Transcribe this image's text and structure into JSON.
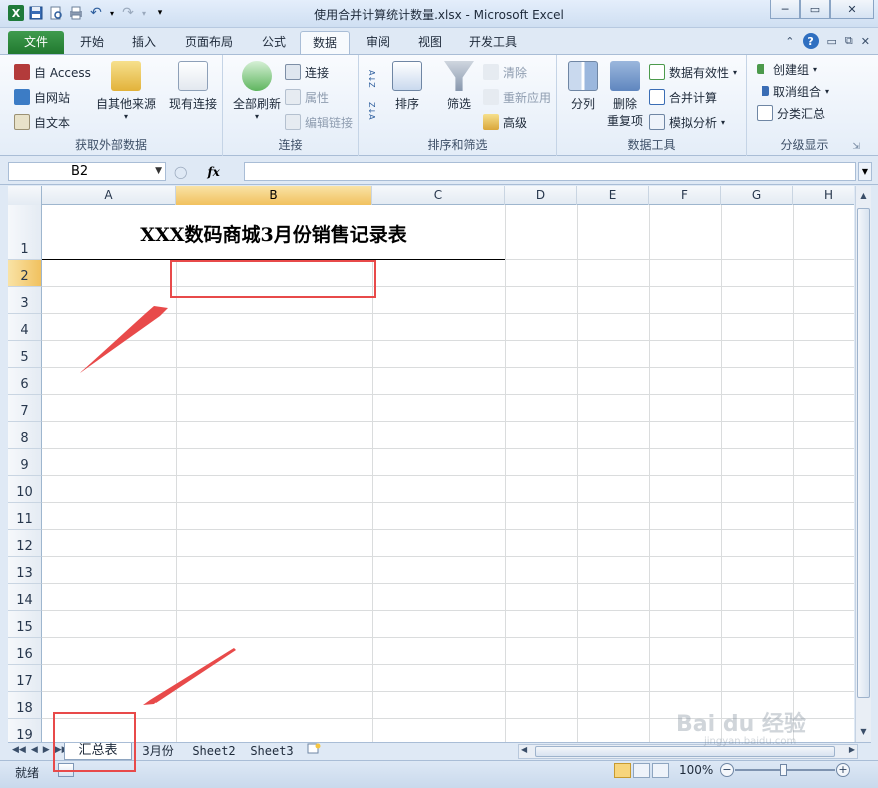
{
  "window": {
    "title": "使用合并计算统计数量.xlsx - Microsoft Excel",
    "minimize": "─",
    "maximize": "▭",
    "close": "✕"
  },
  "quick_access": {
    "excel_icon_label": "X",
    "undo": "↶",
    "redo": "↷",
    "more": "▾"
  },
  "ribbon_tabs": {
    "file": "文件",
    "home": "开始",
    "insert": "插入",
    "page_layout": "页面布局",
    "formulas": "公式",
    "data": "数据",
    "review": "审阅",
    "view": "视图",
    "developer": "开发工具",
    "help": "?"
  },
  "ribbon": {
    "get_external": {
      "access": "自 Access",
      "web": "自网站",
      "text": "自文本",
      "other_sources": "自其他来源",
      "existing_connections": "现有连接",
      "label": "获取外部数据"
    },
    "connections": {
      "refresh_all": "全部刷新",
      "connections": "连接",
      "properties": "属性",
      "edit_links": "编辑链接",
      "label": "连接"
    },
    "sort_filter": {
      "sort_az": "A↓Z",
      "sort_za": "Z↓A",
      "sort": "排序",
      "filter": "筛选",
      "clear": "清除",
      "reapply": "重新应用",
      "advanced": "高级",
      "label": "排序和筛选"
    },
    "data_tools": {
      "text_to_columns": "分列",
      "remove_duplicates_1": "删除",
      "remove_duplicates_2": "重复项",
      "data_validation": "数据有效性",
      "consolidate": "合并计算",
      "what_if": "模拟分析",
      "label": "数据工具"
    },
    "outline": {
      "group": "创建组",
      "ungroup": "取消组合",
      "subtotal": "分类汇总",
      "label": "分级显示"
    }
  },
  "formula_bar": {
    "name_box": "B2",
    "fx": "fx",
    "content": ""
  },
  "columns": [
    "A",
    "B",
    "C",
    "D",
    "E",
    "F",
    "G",
    "H"
  ],
  "rows": [
    "1",
    "2",
    "3",
    "4",
    "5",
    "6",
    "7",
    "8",
    "9",
    "10",
    "11",
    "12",
    "13",
    "14",
    "15",
    "16",
    "17",
    "18",
    "19"
  ],
  "sheet": {
    "title": "XXX数码商城3月份销售记录表",
    "selected_cell": "B2"
  },
  "sheet_tabs": [
    "汇总表",
    "3月份",
    "Sheet2",
    "Sheet3"
  ],
  "status": {
    "ready": "就绪",
    "zoom": "100%"
  },
  "colors": {
    "annotation": "#e84a4a",
    "file_tab": "#2e8b3e",
    "selection_header": "#f1c15f"
  },
  "watermark": {
    "brand": "Bai du 经验",
    "url": "jingyan.baidu.com"
  }
}
